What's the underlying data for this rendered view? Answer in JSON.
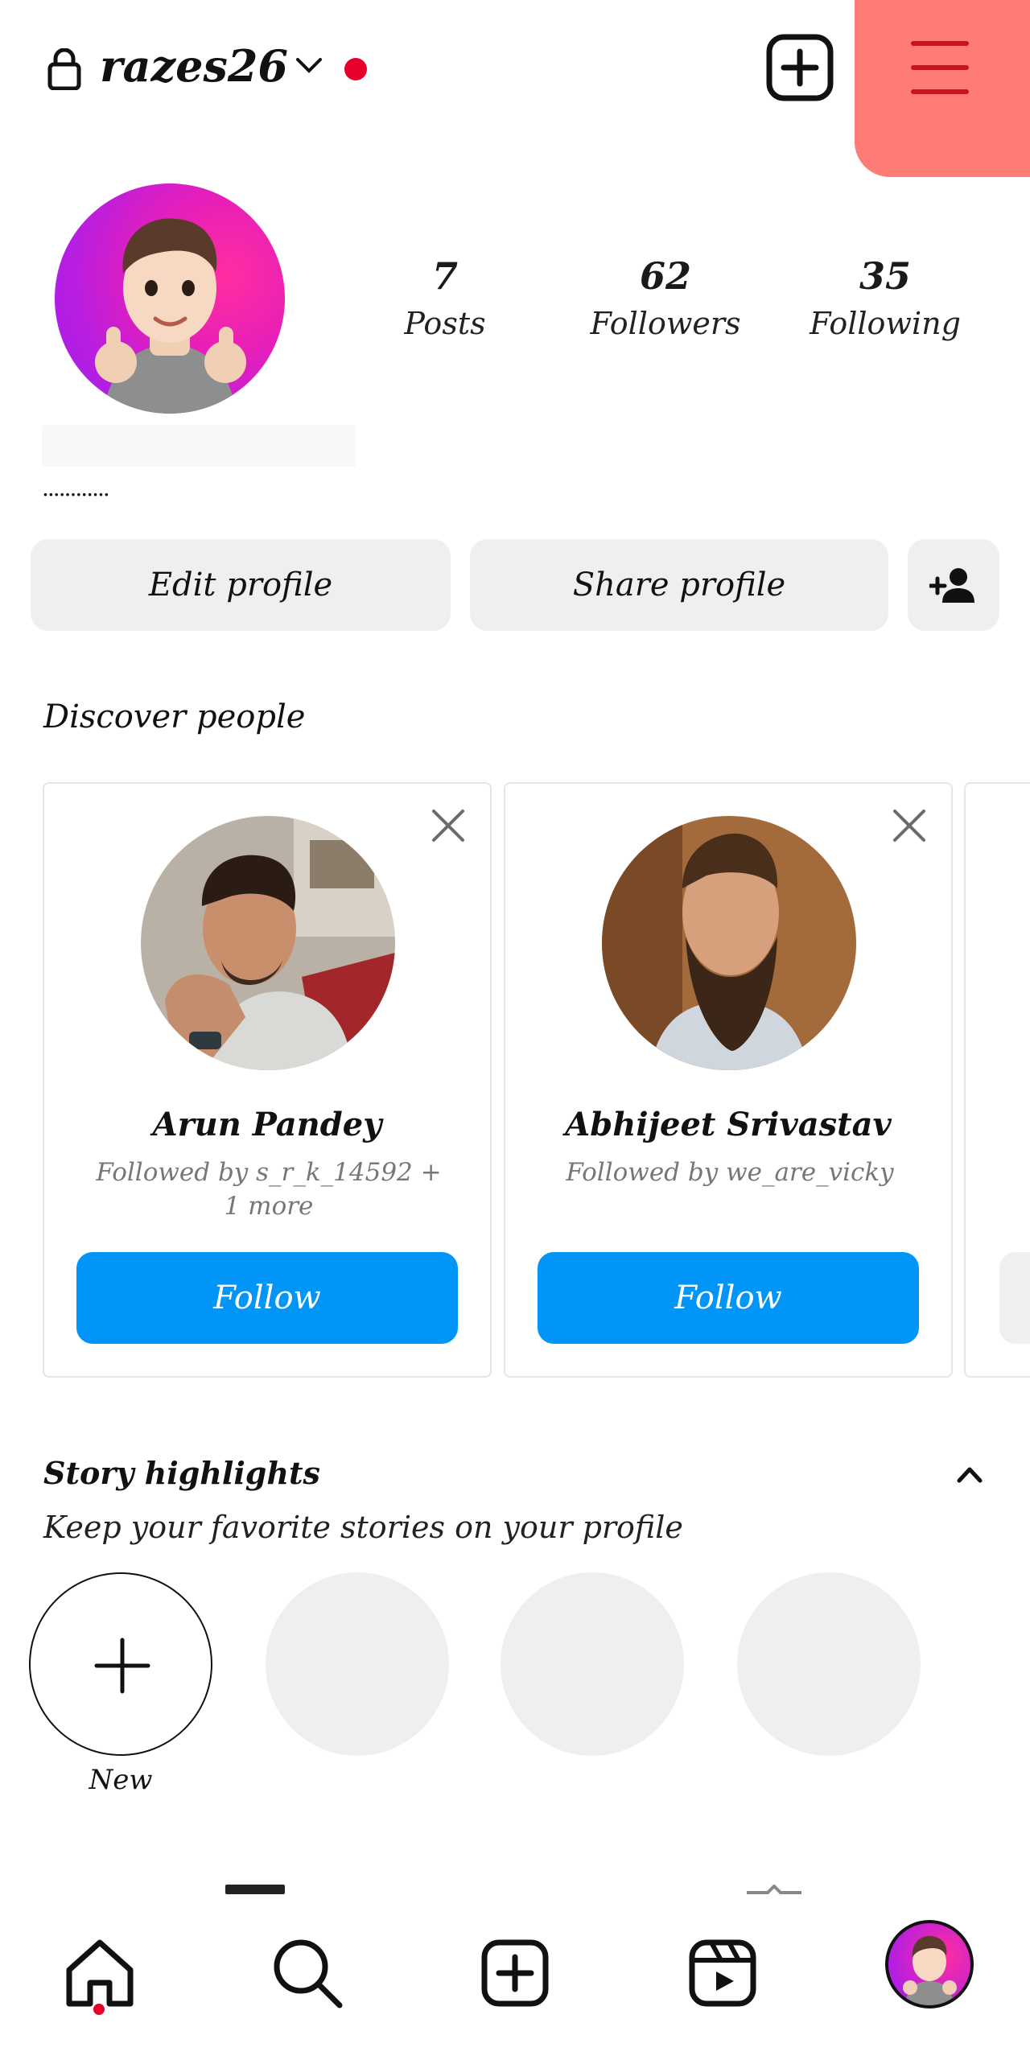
{
  "header": {
    "username": "razes26",
    "notification_color": "#e8002b",
    "icons": [
      "lock-icon",
      "chevron-down-icon",
      "create-plus-icon",
      "menu-icon"
    ],
    "menu_highlight_color": "#ff7b76"
  },
  "profile": {
    "stats": [
      {
        "value": "7",
        "label": "Posts"
      },
      {
        "value": "62",
        "label": "Followers"
      },
      {
        "value": "35",
        "label": "Following"
      }
    ],
    "bio": "............",
    "buttons": {
      "edit": "Edit profile",
      "share": "Share profile"
    }
  },
  "discover": {
    "title": "Discover people",
    "cards": [
      {
        "name": "Arun Pandey",
        "subtitle": "Followed by s_r_k_14592 + 1 more",
        "action": "Follow"
      },
      {
        "name": "Abhijeet Srivastav",
        "subtitle": "Followed by we_are_vicky",
        "action": "Follow"
      }
    ],
    "follow_color": "#0095f6"
  },
  "highlights": {
    "title": "Story highlights",
    "subtitle": "Keep your favorite stories on your profile",
    "new_label": "New"
  },
  "nav": {
    "items": [
      "home-icon",
      "search-icon",
      "create-icon",
      "reels-icon",
      "profile-avatar"
    ],
    "active": "home-icon"
  }
}
